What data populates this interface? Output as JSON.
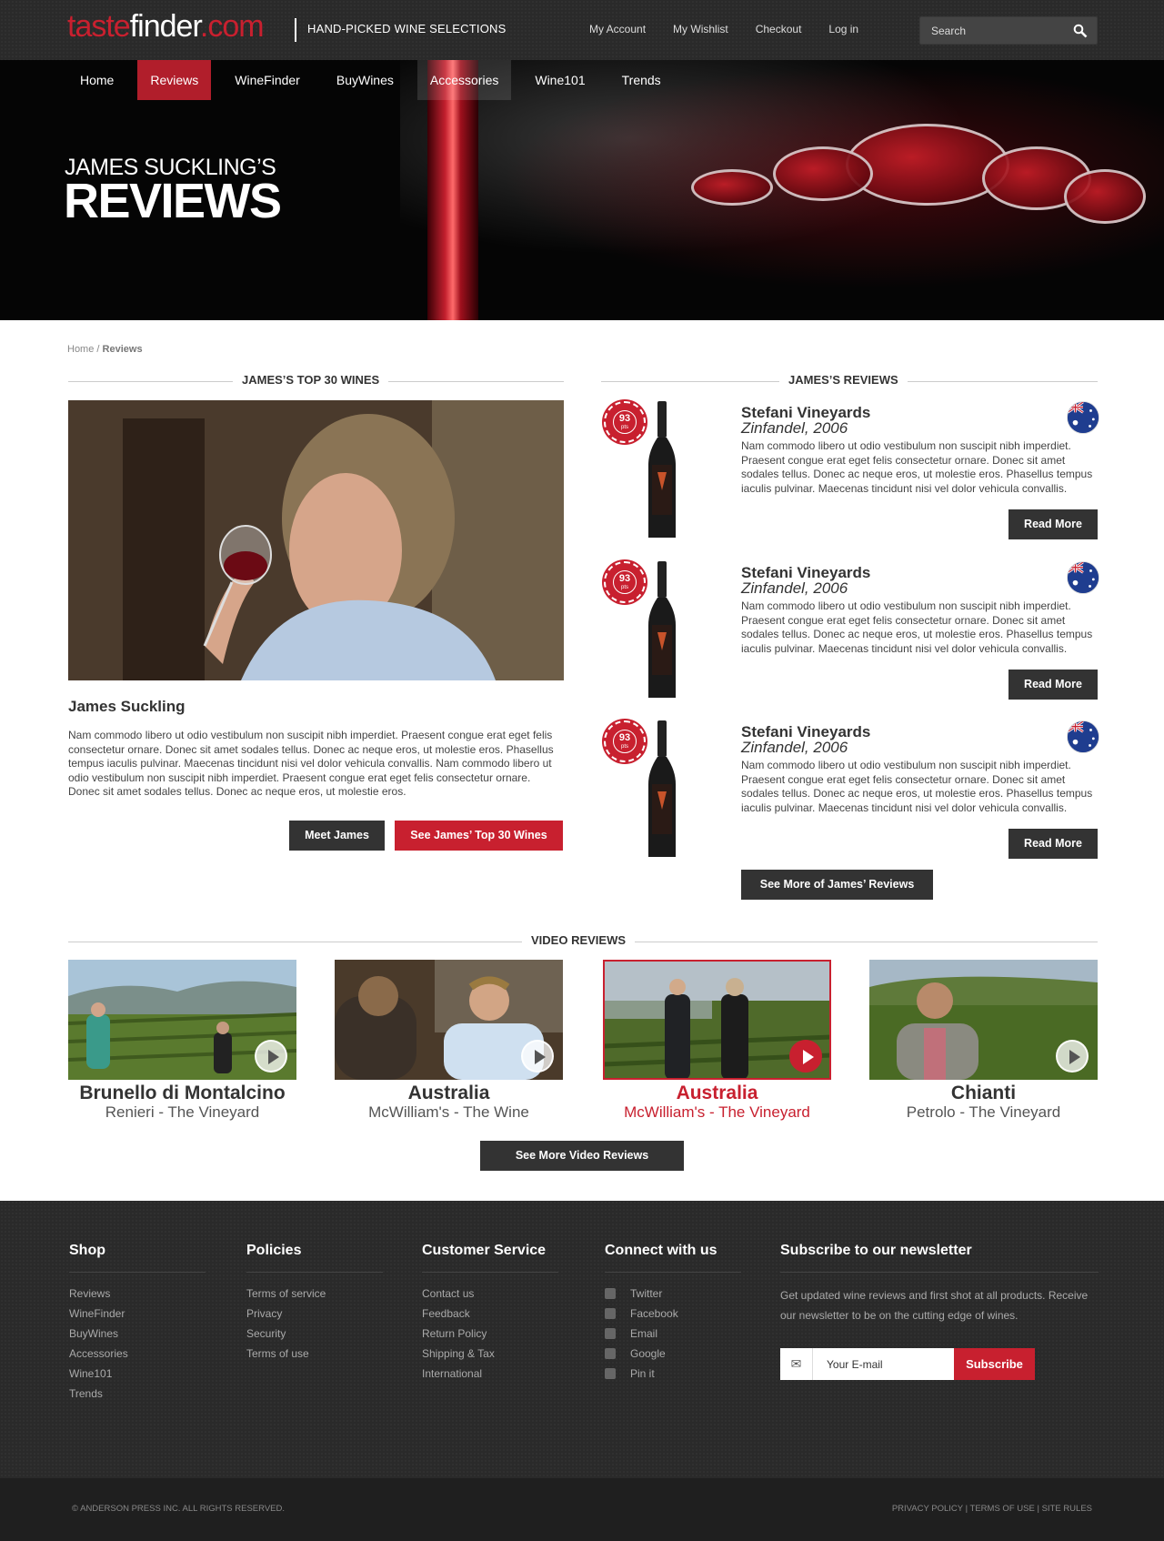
{
  "header": {
    "logo_taste": "taste",
    "logo_finder": "finder",
    "logo_com": ".com",
    "tagline": "HAND-PICKED WINE SELECTIONS",
    "links": [
      "My Account",
      "My Wishlist",
      "Checkout",
      "Log in"
    ],
    "search_placeholder": "Search"
  },
  "nav": {
    "items": [
      "Home",
      "Reviews",
      "WineFinder",
      "BuyWines",
      "Accessories",
      "Wine101",
      "Trends"
    ],
    "active": "Reviews"
  },
  "hero": {
    "subtitle": "JAMES SUCKLING’S",
    "title": "REVIEWS"
  },
  "breadcrumb": {
    "home": "Home",
    "sep": "/",
    "current": "Reviews"
  },
  "left": {
    "heading": "JAMES’S TOP 30 WINES",
    "name": "James Suckling",
    "bio": "Nam commodo libero ut odio vestibulum non suscipit nibh imperdiet. Praesent congue erat eget felis consectetur ornare. Donec sit amet sodales tellus. Donec ac neque eros, ut molestie eros. Phasellus tempus iaculis pulvinar. Maecenas tincidunt nisi vel dolor vehicula convallis. Nam commodo libero ut odio vestibulum non suscipit nibh imperdiet. Praesent congue erat eget felis consectetur ornare. Donec sit amet sodales tellus. Donec ac neque eros, ut molestie eros.",
    "meet_button": "Meet James",
    "top30_button": "See James’ Top 30 Wines"
  },
  "reviews": {
    "heading": "JAMES’S REVIEWS",
    "items": [
      {
        "score": "93",
        "pts": "pts",
        "winery": "Stefani Vineyards",
        "wine": "Zinfandel, 2006",
        "text": "Nam commodo libero ut odio vestibulum non suscipit nibh imperdiet. Praesent congue erat eget felis consectetur ornare. Donec sit amet sodales tellus. Donec ac neque eros, ut molestie eros. Phasellus tempus iaculis pulvinar. Maecenas tincidunt nisi vel dolor vehicula convallis.",
        "button": "Read More"
      },
      {
        "score": "93",
        "pts": "pts",
        "winery": "Stefani Vineyards",
        "wine": "Zinfandel, 2006",
        "text": "Nam commodo libero ut odio vestibulum non suscipit nibh imperdiet. Praesent congue erat eget felis consectetur ornare. Donec sit amet sodales tellus. Donec ac neque eros, ut molestie eros. Phasellus tempus iaculis pulvinar. Maecenas tincidunt nisi vel dolor vehicula convallis.",
        "button": "Read More"
      },
      {
        "score": "93",
        "pts": "pts",
        "winery": "Stefani Vineyards",
        "wine": "Zinfandel, 2006",
        "text": "Nam commodo libero ut odio vestibulum non suscipit nibh imperdiet. Praesent congue erat eget felis consectetur ornare. Donec sit amet sodales tellus. Donec ac neque eros, ut molestie eros. Phasellus tempus iaculis pulvinar. Maecenas tincidunt nisi vel dolor vehicula convallis.",
        "button": "Read More"
      }
    ],
    "more_button": "See More of James’ Reviews"
  },
  "videos": {
    "heading": "VIDEO REVIEWS",
    "items": [
      {
        "title": "Brunello di Montalcino",
        "subtitle": "Renieri - The Vineyard"
      },
      {
        "title": "Australia",
        "subtitle": "McWilliam's - The Wine"
      },
      {
        "title": "Australia",
        "subtitle": "McWilliam's - The Vineyard"
      },
      {
        "title": "Chianti",
        "subtitle": "Petrolo - The Vineyard"
      }
    ],
    "selected_index": 2,
    "more_button": "See More Video Reviews"
  },
  "footer": {
    "shop": {
      "title": "Shop",
      "links": [
        "Reviews",
        "WineFinder",
        "BuyWines",
        "Accessories",
        "Wine101",
        "Trends"
      ]
    },
    "policies": {
      "title": "Policies",
      "links": [
        "Terms of service",
        "Privacy",
        "Security",
        "Terms of use"
      ]
    },
    "service": {
      "title": "Customer Service",
      "links": [
        "Contact us",
        "Feedback",
        "Return Policy",
        "Shipping & Tax",
        "International"
      ]
    },
    "connect": {
      "title": "Connect with us",
      "links": [
        "Twitter",
        "Facebook",
        "Email",
        "Google",
        "Pin it"
      ]
    },
    "newsletter": {
      "title": "Subscribe to our newsletter",
      "text": "Get updated wine reviews and first shot at all products. Receive our newsletter to be on the cutting edge of wines.",
      "placeholder": "Your E-mail",
      "button": "Subscribe"
    },
    "copyright": "© ANDERSON PRESS INC.   ALL RIGHTS RESERVED.",
    "legal": [
      "PRIVACY POLICY",
      "TERMS OF USE",
      "SITE RULES"
    ]
  },
  "colors": {
    "accent": "#c8202f",
    "dark": "#2a2a2a",
    "button": "#333333"
  }
}
